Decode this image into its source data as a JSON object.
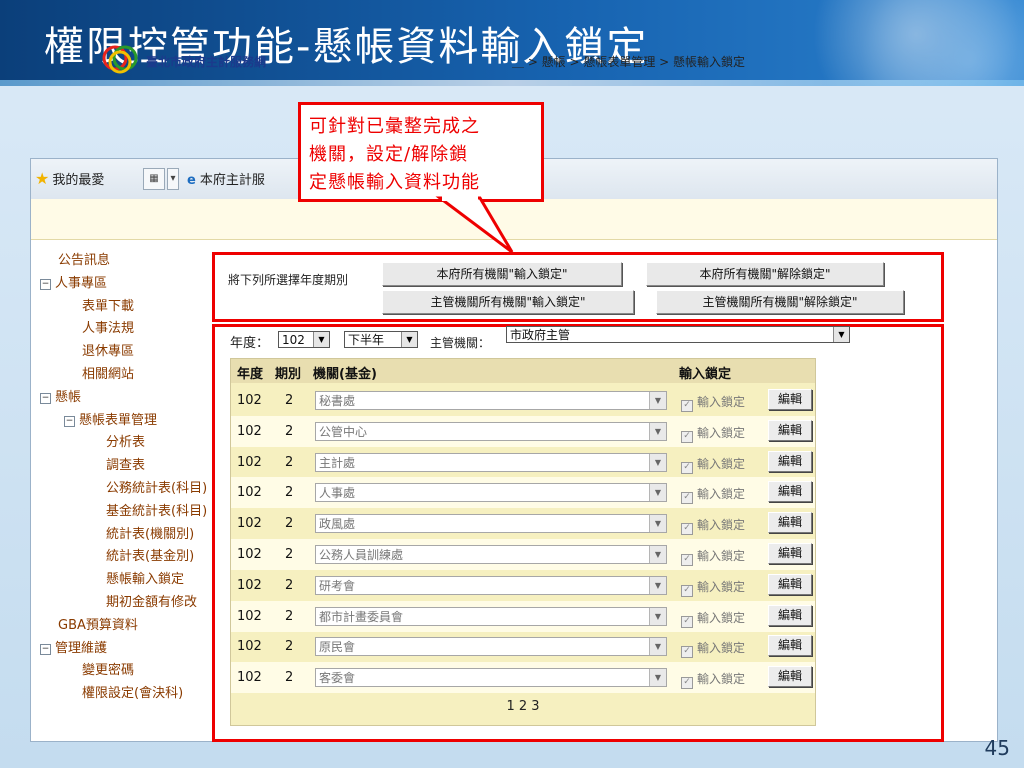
{
  "slide": {
    "title": "權限控管功能-懸帳資料輸入鎖定",
    "page_number": "45",
    "callout": [
      "可針對已彙整完成之",
      "機關，設定/解除鎖",
      "定懸帳輸入資料功能"
    ]
  },
  "browser_toolbar": {
    "favorites_label": "我的最愛",
    "tab_label": "本府主計服"
  },
  "site": {
    "name": "臺北市政府主計服務網",
    "breadcrumb": "＿ > 懸帳 > 懸帳表單管理 > 懸帳輸入鎖定"
  },
  "sidebar": {
    "items": [
      {
        "label": "公告訊息",
        "toggle": ""
      },
      {
        "label": "人事專區",
        "toggle": "−"
      },
      {
        "label": "表單下載",
        "toggle": ""
      },
      {
        "label": "人事法規",
        "toggle": ""
      },
      {
        "label": "退休專區",
        "toggle": ""
      },
      {
        "label": "相關網站",
        "toggle": ""
      },
      {
        "label": "懸帳",
        "toggle": "−"
      },
      {
        "label": "懸帳表單管理",
        "toggle": "−"
      },
      {
        "label": "分析表",
        "toggle": ""
      },
      {
        "label": "調查表",
        "toggle": ""
      },
      {
        "label": "公務統計表(科目)",
        "toggle": ""
      },
      {
        "label": "基金統計表(科目)",
        "toggle": ""
      },
      {
        "label": "統計表(機關別)",
        "toggle": ""
      },
      {
        "label": "統計表(基金別)",
        "toggle": ""
      },
      {
        "label": "懸帳輸入鎖定",
        "toggle": ""
      },
      {
        "label": "期初金額有修改",
        "toggle": ""
      },
      {
        "label": "GBA預算資料",
        "toggle": ""
      },
      {
        "label": "管理維護",
        "toggle": "−"
      },
      {
        "label": "變更密碼",
        "toggle": ""
      },
      {
        "label": "權限設定(會決科)",
        "toggle": ""
      }
    ]
  },
  "actions": {
    "label": "將下列所選擇年度期別",
    "lock_all_city": "本府所有機關\"輸入鎖定\"",
    "unlock_all_city": "本府所有機關\"解除鎖定\"",
    "lock_all_competent": "主管機關所有機關\"輸入鎖定\"",
    "unlock_all_competent": "主管機關所有機關\"解除鎖定\""
  },
  "filters": {
    "year_label": "年度：",
    "year_value": "102",
    "period_value": "下半年",
    "competent_label": "主管機關：",
    "competent_value": "市政府主管"
  },
  "grid": {
    "headers": [
      "年度",
      "期別",
      "機關(基金)",
      "輸入鎖定"
    ],
    "lock_label": "輸入鎖定",
    "edit_label": "編輯",
    "rows": [
      {
        "year": "102",
        "period": "2",
        "agency": "秘書處"
      },
      {
        "year": "102",
        "period": "2",
        "agency": "公管中心"
      },
      {
        "year": "102",
        "period": "2",
        "agency": "主計處"
      },
      {
        "year": "102",
        "period": "2",
        "agency": "人事處"
      },
      {
        "year": "102",
        "period": "2",
        "agency": "政風處"
      },
      {
        "year": "102",
        "period": "2",
        "agency": "公務人員訓練處"
      },
      {
        "year": "102",
        "period": "2",
        "agency": "研考會"
      },
      {
        "year": "102",
        "period": "2",
        "agency": "都市計畫委員會"
      },
      {
        "year": "102",
        "period": "2",
        "agency": "原民會"
      },
      {
        "year": "102",
        "period": "2",
        "agency": "客委會"
      }
    ],
    "pager": "1 2 3"
  }
}
